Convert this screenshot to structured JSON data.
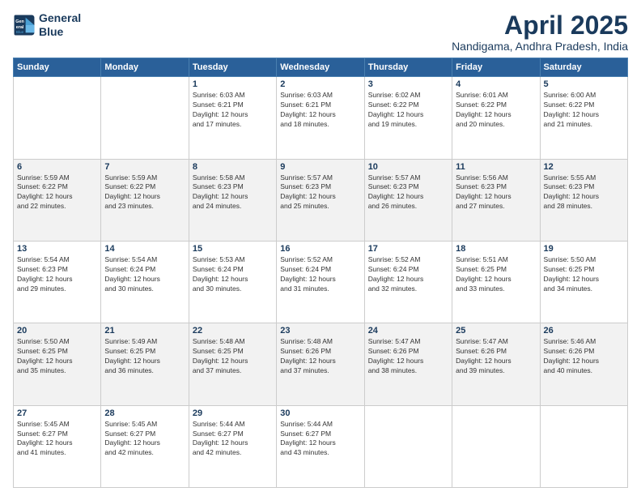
{
  "logo": {
    "line1": "General",
    "line2": "Blue"
  },
  "title": "April 2025",
  "subtitle": "Nandigama, Andhra Pradesh, India",
  "headers": [
    "Sunday",
    "Monday",
    "Tuesday",
    "Wednesday",
    "Thursday",
    "Friday",
    "Saturday"
  ],
  "weeks": [
    [
      {
        "day": "",
        "info": ""
      },
      {
        "day": "",
        "info": ""
      },
      {
        "day": "1",
        "info": "Sunrise: 6:03 AM\nSunset: 6:21 PM\nDaylight: 12 hours\nand 17 minutes."
      },
      {
        "day": "2",
        "info": "Sunrise: 6:03 AM\nSunset: 6:21 PM\nDaylight: 12 hours\nand 18 minutes."
      },
      {
        "day": "3",
        "info": "Sunrise: 6:02 AM\nSunset: 6:22 PM\nDaylight: 12 hours\nand 19 minutes."
      },
      {
        "day": "4",
        "info": "Sunrise: 6:01 AM\nSunset: 6:22 PM\nDaylight: 12 hours\nand 20 minutes."
      },
      {
        "day": "5",
        "info": "Sunrise: 6:00 AM\nSunset: 6:22 PM\nDaylight: 12 hours\nand 21 minutes."
      }
    ],
    [
      {
        "day": "6",
        "info": "Sunrise: 5:59 AM\nSunset: 6:22 PM\nDaylight: 12 hours\nand 22 minutes."
      },
      {
        "day": "7",
        "info": "Sunrise: 5:59 AM\nSunset: 6:22 PM\nDaylight: 12 hours\nand 23 minutes."
      },
      {
        "day": "8",
        "info": "Sunrise: 5:58 AM\nSunset: 6:23 PM\nDaylight: 12 hours\nand 24 minutes."
      },
      {
        "day": "9",
        "info": "Sunrise: 5:57 AM\nSunset: 6:23 PM\nDaylight: 12 hours\nand 25 minutes."
      },
      {
        "day": "10",
        "info": "Sunrise: 5:57 AM\nSunset: 6:23 PM\nDaylight: 12 hours\nand 26 minutes."
      },
      {
        "day": "11",
        "info": "Sunrise: 5:56 AM\nSunset: 6:23 PM\nDaylight: 12 hours\nand 27 minutes."
      },
      {
        "day": "12",
        "info": "Sunrise: 5:55 AM\nSunset: 6:23 PM\nDaylight: 12 hours\nand 28 minutes."
      }
    ],
    [
      {
        "day": "13",
        "info": "Sunrise: 5:54 AM\nSunset: 6:23 PM\nDaylight: 12 hours\nand 29 minutes."
      },
      {
        "day": "14",
        "info": "Sunrise: 5:54 AM\nSunset: 6:24 PM\nDaylight: 12 hours\nand 30 minutes."
      },
      {
        "day": "15",
        "info": "Sunrise: 5:53 AM\nSunset: 6:24 PM\nDaylight: 12 hours\nand 30 minutes."
      },
      {
        "day": "16",
        "info": "Sunrise: 5:52 AM\nSunset: 6:24 PM\nDaylight: 12 hours\nand 31 minutes."
      },
      {
        "day": "17",
        "info": "Sunrise: 5:52 AM\nSunset: 6:24 PM\nDaylight: 12 hours\nand 32 minutes."
      },
      {
        "day": "18",
        "info": "Sunrise: 5:51 AM\nSunset: 6:25 PM\nDaylight: 12 hours\nand 33 minutes."
      },
      {
        "day": "19",
        "info": "Sunrise: 5:50 AM\nSunset: 6:25 PM\nDaylight: 12 hours\nand 34 minutes."
      }
    ],
    [
      {
        "day": "20",
        "info": "Sunrise: 5:50 AM\nSunset: 6:25 PM\nDaylight: 12 hours\nand 35 minutes."
      },
      {
        "day": "21",
        "info": "Sunrise: 5:49 AM\nSunset: 6:25 PM\nDaylight: 12 hours\nand 36 minutes."
      },
      {
        "day": "22",
        "info": "Sunrise: 5:48 AM\nSunset: 6:25 PM\nDaylight: 12 hours\nand 37 minutes."
      },
      {
        "day": "23",
        "info": "Sunrise: 5:48 AM\nSunset: 6:26 PM\nDaylight: 12 hours\nand 37 minutes."
      },
      {
        "day": "24",
        "info": "Sunrise: 5:47 AM\nSunset: 6:26 PM\nDaylight: 12 hours\nand 38 minutes."
      },
      {
        "day": "25",
        "info": "Sunrise: 5:47 AM\nSunset: 6:26 PM\nDaylight: 12 hours\nand 39 minutes."
      },
      {
        "day": "26",
        "info": "Sunrise: 5:46 AM\nSunset: 6:26 PM\nDaylight: 12 hours\nand 40 minutes."
      }
    ],
    [
      {
        "day": "27",
        "info": "Sunrise: 5:45 AM\nSunset: 6:27 PM\nDaylight: 12 hours\nand 41 minutes."
      },
      {
        "day": "28",
        "info": "Sunrise: 5:45 AM\nSunset: 6:27 PM\nDaylight: 12 hours\nand 42 minutes."
      },
      {
        "day": "29",
        "info": "Sunrise: 5:44 AM\nSunset: 6:27 PM\nDaylight: 12 hours\nand 42 minutes."
      },
      {
        "day": "30",
        "info": "Sunrise: 5:44 AM\nSunset: 6:27 PM\nDaylight: 12 hours\nand 43 minutes."
      },
      {
        "day": "",
        "info": ""
      },
      {
        "day": "",
        "info": ""
      },
      {
        "day": "",
        "info": ""
      }
    ]
  ]
}
